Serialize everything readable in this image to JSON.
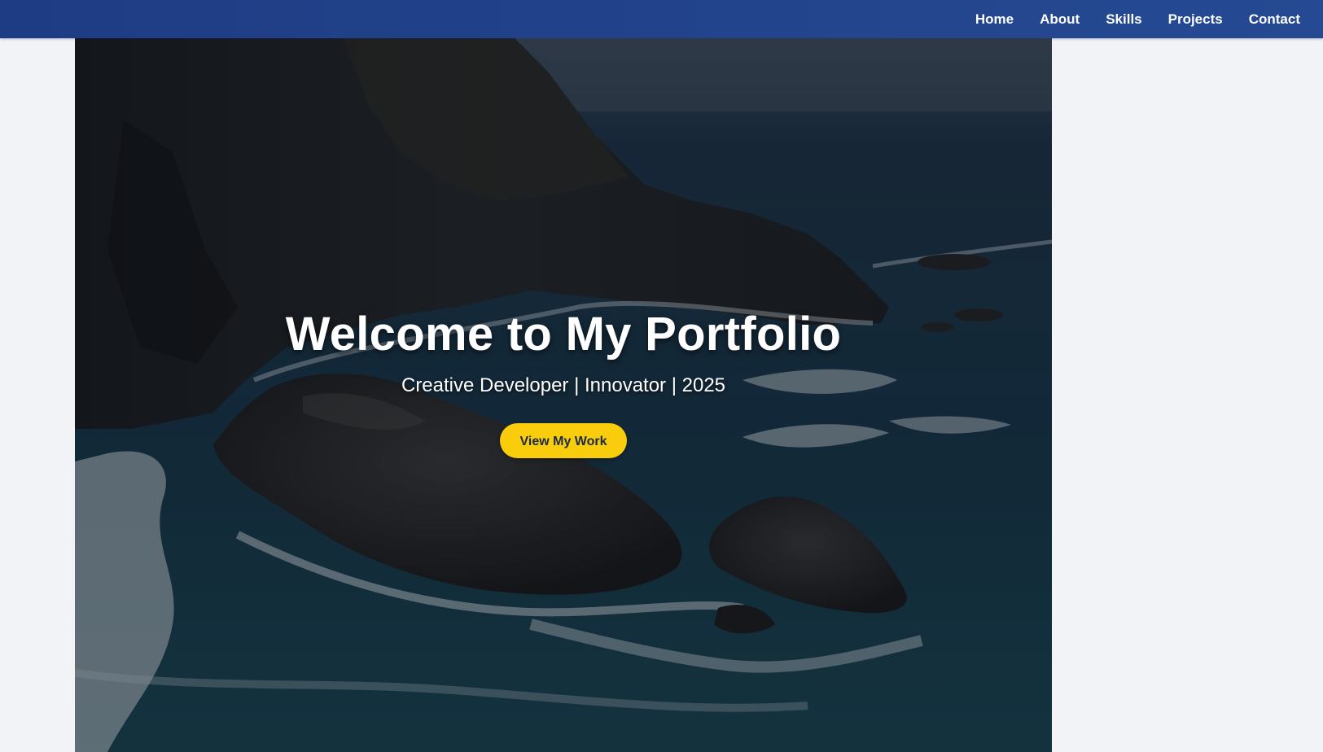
{
  "nav": {
    "links": [
      {
        "label": "Home"
      },
      {
        "label": "About"
      },
      {
        "label": "Skills"
      },
      {
        "label": "Projects"
      },
      {
        "label": "Contact"
      }
    ]
  },
  "hero": {
    "title": "Welcome to My Portfolio",
    "subtitle": "Creative Developer | Innovator | 2025",
    "cta_label": "View My Work"
  },
  "colors": {
    "navbar": "#254a93",
    "cta": "#f9cd0b",
    "page_background": "#f2f3f7"
  }
}
